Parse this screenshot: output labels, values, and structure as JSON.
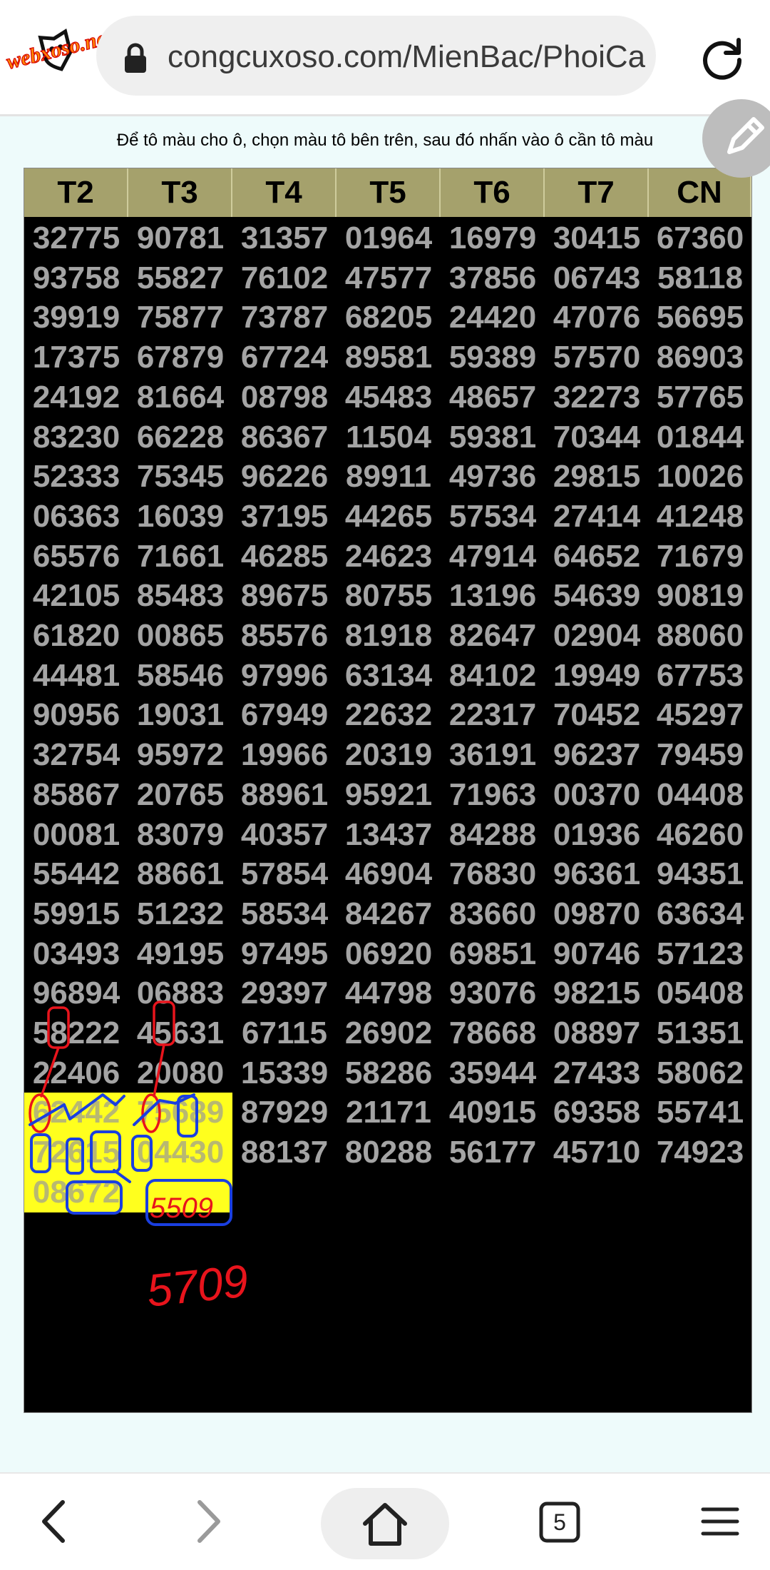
{
  "browser": {
    "url": "congcuxoso.com/MienBac/PhoiCa",
    "logo_text": "webxoso.net",
    "tab_count": "5"
  },
  "page": {
    "instruction": "Để tô màu cho ô, chọn màu tô bên trên, sau đó nhấn vào ô cần tô màu",
    "columns": [
      "T2",
      "T3",
      "T4",
      "T5",
      "T6",
      "T7",
      "CN"
    ],
    "rows": [
      [
        "32775",
        "90781",
        "31357",
        "01964",
        "16979",
        "30415",
        "67360"
      ],
      [
        "93758",
        "55827",
        "76102",
        "47577",
        "37856",
        "06743",
        "58118"
      ],
      [
        "39919",
        "75877",
        "73787",
        "68205",
        "24420",
        "47076",
        "56695"
      ],
      [
        "17375",
        "67879",
        "67724",
        "89581",
        "59389",
        "57570",
        "86903"
      ],
      [
        "24192",
        "81664",
        "08798",
        "45483",
        "48657",
        "32273",
        "57765"
      ],
      [
        "83230",
        "66228",
        "86367",
        "11504",
        "59381",
        "70344",
        "01844"
      ],
      [
        "52333",
        "75345",
        "96226",
        "89911",
        "49736",
        "29815",
        "10026"
      ],
      [
        "06363",
        "16039",
        "37195",
        "44265",
        "57534",
        "27414",
        "41248"
      ],
      [
        "65576",
        "71661",
        "46285",
        "24623",
        "47914",
        "64652",
        "71679"
      ],
      [
        "42105",
        "85483",
        "89675",
        "80755",
        "13196",
        "54639",
        "90819"
      ],
      [
        "61820",
        "00865",
        "85576",
        "81918",
        "82647",
        "02904",
        "88060"
      ],
      [
        "44481",
        "58546",
        "97996",
        "63134",
        "84102",
        "19949",
        "67753"
      ],
      [
        "90956",
        "19031",
        "67949",
        "22632",
        "22317",
        "70452",
        "45297"
      ],
      [
        "32754",
        "95972",
        "19966",
        "20319",
        "36191",
        "96237",
        "79459"
      ],
      [
        "85867",
        "20765",
        "88961",
        "95921",
        "71963",
        "00370",
        "04408"
      ],
      [
        "00081",
        "83079",
        "40357",
        "13437",
        "84288",
        "01936",
        "46260"
      ],
      [
        "55442",
        "88661",
        "57854",
        "46904",
        "76830",
        "96361",
        "94351"
      ],
      [
        "59915",
        "51232",
        "58534",
        "84267",
        "83660",
        "09870",
        "63634"
      ],
      [
        "03493",
        "49195",
        "97495",
        "06920",
        "69851",
        "90746",
        "57123"
      ],
      [
        "96894",
        "06883",
        "29397",
        "44798",
        "93076",
        "98215",
        "05408"
      ],
      [
        "58222",
        "45631",
        "67115",
        "26902",
        "78668",
        "08897",
        "51351"
      ],
      [
        "22406",
        "20080",
        "15339",
        "58286",
        "35944",
        "27433",
        "58062"
      ],
      [
        "62442",
        "75689",
        "87929",
        "21171",
        "40915",
        "69358",
        "55741"
      ],
      [
        "72615",
        "04430",
        "88137",
        "80288",
        "56177",
        "45710",
        "74923"
      ],
      [
        "08672",
        "",
        "",
        "",
        "",
        "",
        ""
      ]
    ],
    "highlight_color": "#ffff1e",
    "annotations": {
      "red_digits_cell": "5509",
      "red_digits_below": "5709"
    }
  }
}
